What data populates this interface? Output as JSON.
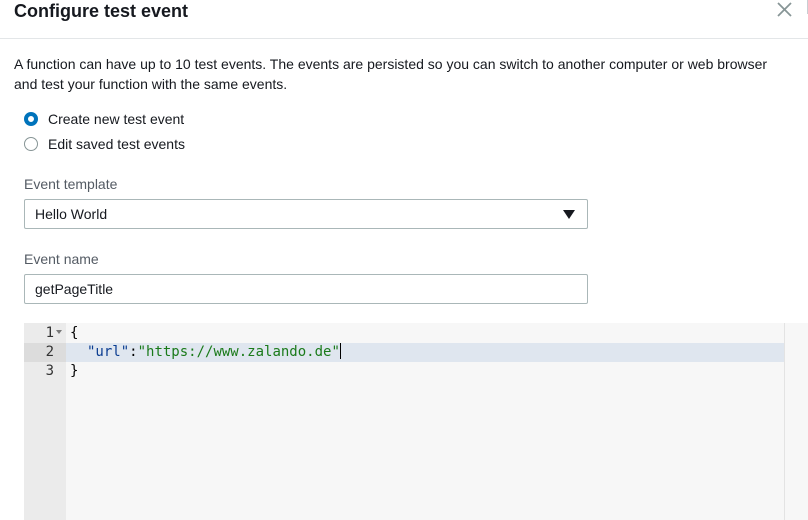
{
  "dialog": {
    "title": "Configure test event",
    "description": "A function can have up to 10 test events. The events are persisted so you can switch to another computer or web browser and test your function with the same events."
  },
  "options": {
    "create_label": "Create new test event",
    "create_selected": true,
    "edit_label": "Edit saved test events",
    "edit_selected": false
  },
  "template": {
    "label": "Event template",
    "value": "Hello World"
  },
  "event_name": {
    "label": "Event name",
    "value": "getPageTitle"
  },
  "editor": {
    "line_numbers": [
      "1",
      "2",
      "3"
    ],
    "line1": "{",
    "line2_key": "\"url\"",
    "line2_colon": ":",
    "line2_value": "\"https://www.zalando.de\"",
    "line3": "}"
  },
  "icons": {
    "close": "close-icon",
    "dropdown": "caret-down-icon",
    "fold": "fold-arrow-icon"
  },
  "colors": {
    "accent": "#0073bb",
    "json_key": "#0b3d91",
    "json_string": "#1a7a1a",
    "active_line": "#dfe6ef"
  }
}
